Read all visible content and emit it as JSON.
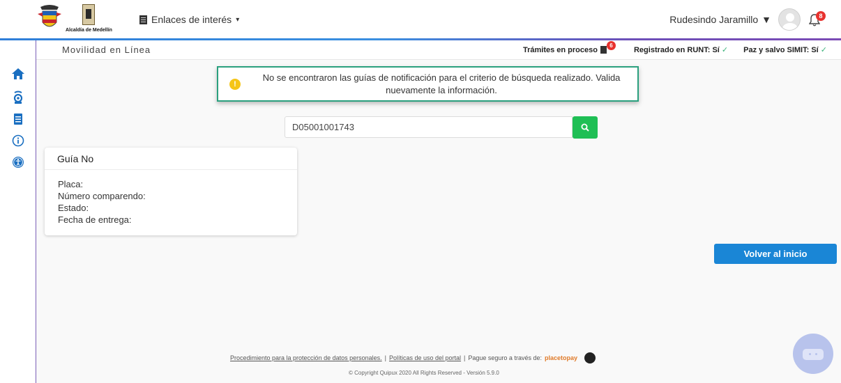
{
  "header": {
    "links_label": "Enlaces de interés",
    "logo_medellin_text": "Alcaldía de Medellín",
    "user_name": "Rudesindo Jaramillo",
    "notifications_count": "8"
  },
  "subheader": {
    "title": "Movilidad en Línea",
    "tramites_label": "Trámites en proceso",
    "tramites_count": "6",
    "runt_label": "Registrado en RUNT: Sí",
    "simit_label": "Paz y salvo SIMIT: Sí"
  },
  "sidebar": {
    "items": [
      {
        "icon": "home-icon"
      },
      {
        "icon": "camera-icon"
      },
      {
        "icon": "notebook-icon"
      },
      {
        "icon": "info-icon"
      },
      {
        "icon": "accessibility-icon"
      }
    ]
  },
  "alert": {
    "message": "No se encontraron las guías de notificación para el criterio de búsqueda realizado. Valida nuevamente la información.",
    "icon": "!"
  },
  "search": {
    "value": "D05001001743"
  },
  "card": {
    "title": "Guía No",
    "fields": [
      "Placa:",
      "Número comparendo:",
      "Estado:",
      "Fecha de entrega:"
    ]
  },
  "actions": {
    "home_button": "Volver al inicio"
  },
  "footer": {
    "link_privacy": "Procedimiento para la protección de datos personales.",
    "link_policies": "Políticas de uso del portal",
    "separator": "|",
    "payment_text": "Pague seguro a través de:",
    "payment_brand": "placetopay",
    "copyright": "© Copyright Quipux 2020 All Rights Reserved - Versión 5.9.0"
  },
  "colors": {
    "primary": "#1a86d6",
    "success": "#1fbf55",
    "alert_border": "#2aa07e",
    "badge": "#e8322e"
  }
}
